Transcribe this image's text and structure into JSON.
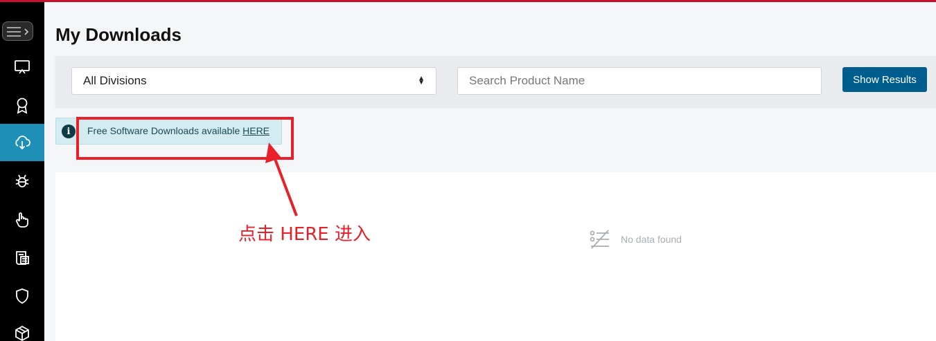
{
  "page": {
    "title": "My Downloads"
  },
  "sidebar": {
    "items": [
      {
        "icon": "monitor-icon",
        "active": false
      },
      {
        "icon": "award-icon",
        "active": false
      },
      {
        "icon": "cloud-download-icon",
        "active": true
      },
      {
        "icon": "bug-icon",
        "active": false
      },
      {
        "icon": "hand-pointer-icon",
        "active": false
      },
      {
        "icon": "document-list-icon",
        "active": false
      },
      {
        "icon": "shield-icon",
        "active": false
      },
      {
        "icon": "package-icon",
        "active": false
      }
    ]
  },
  "filters": {
    "division_select": "All Divisions",
    "search_placeholder": "Search Product Name",
    "search_value": "",
    "show_results_label": "Show Results"
  },
  "banner": {
    "text": "Free Software Downloads available ",
    "link_label": "HERE"
  },
  "results": {
    "empty_text": "No data found"
  },
  "annotation": {
    "text": "点击 HERE 进入"
  },
  "colors": {
    "accent_red": "#c8102e",
    "sidebar_active": "#1e90b8",
    "button_blue": "#005e8f",
    "annotation_red": "#e8202a"
  }
}
